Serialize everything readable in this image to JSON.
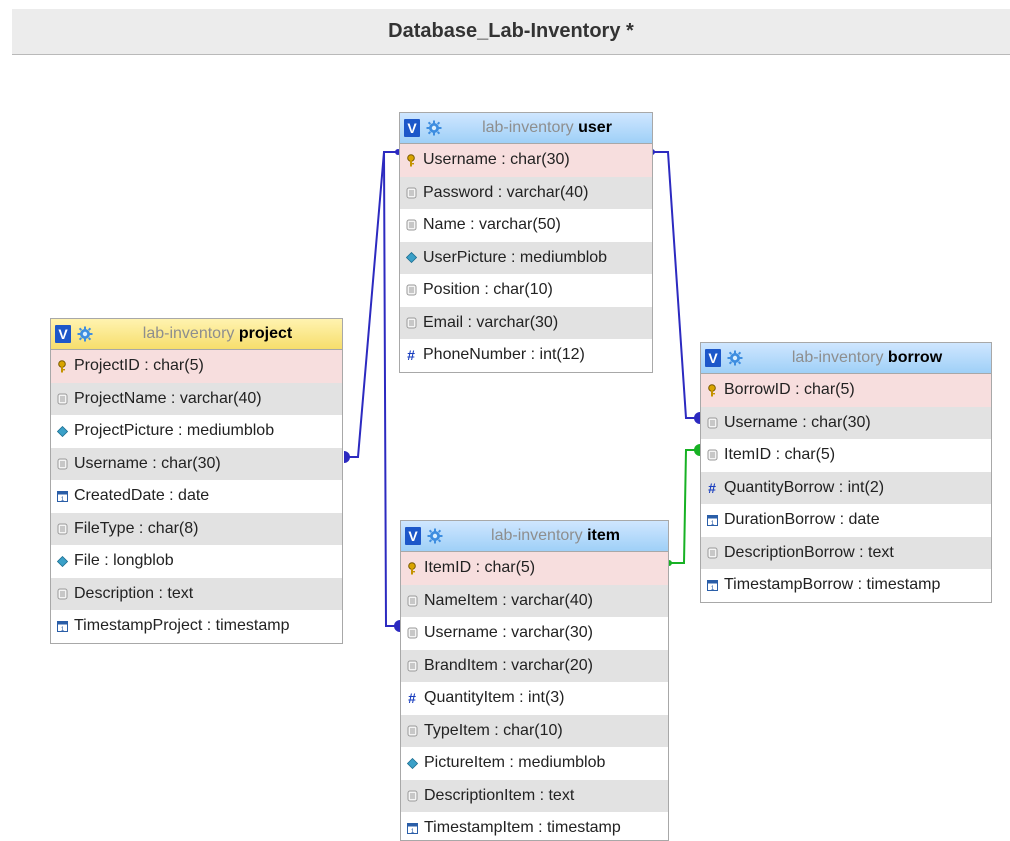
{
  "header": {
    "title": "Database_Lab-Inventory *"
  },
  "colors": {
    "link_blue": "#2c2ac0",
    "link_green": "#17b124",
    "header_blue": "#9fd0f7",
    "header_yellow": "#f7de6c",
    "pk_row": "#f7dede",
    "alt_row": "#e2e2e2"
  },
  "tables": {
    "user": {
      "db": "lab-inventory",
      "name": "user",
      "v_label": "V",
      "columns": [
        {
          "label": "Username : char(30)",
          "icon": "key-icon"
        },
        {
          "label": "Password : varchar(40)",
          "icon": "text-field-icon"
        },
        {
          "label": "Name : varchar(50)",
          "icon": "text-field-icon"
        },
        {
          "label": "UserPicture : mediumblob",
          "icon": "blob-icon"
        },
        {
          "label": "Position : char(10)",
          "icon": "text-field-icon"
        },
        {
          "label": "Email : varchar(30)",
          "icon": "text-field-icon"
        },
        {
          "label": "PhoneNumber : int(12)",
          "icon": "number-icon"
        }
      ]
    },
    "project": {
      "db": "lab-inventory",
      "name": "project",
      "v_label": "V",
      "columns": [
        {
          "label": "ProjectID : char(5)",
          "icon": "key-icon"
        },
        {
          "label": "ProjectName : varchar(40)",
          "icon": "text-field-icon"
        },
        {
          "label": "ProjectPicture : mediumblob",
          "icon": "blob-icon"
        },
        {
          "label": "Username : char(30)",
          "icon": "text-field-icon"
        },
        {
          "label": "CreatedDate : date",
          "icon": "date-icon"
        },
        {
          "label": "FileType : char(8)",
          "icon": "text-field-icon"
        },
        {
          "label": "File : longblob",
          "icon": "blob-icon"
        },
        {
          "label": "Description : text",
          "icon": "text-field-icon"
        },
        {
          "label": "TimestampProject : timestamp",
          "icon": "date-icon"
        }
      ]
    },
    "borrow": {
      "db": "lab-inventory",
      "name": "borrow",
      "v_label": "V",
      "columns": [
        {
          "label": "BorrowID : char(5)",
          "icon": "key-icon"
        },
        {
          "label": "Username : char(30)",
          "icon": "text-field-icon"
        },
        {
          "label": "ItemID : char(5)",
          "icon": "text-field-icon"
        },
        {
          "label": "QuantityBorrow : int(2)",
          "icon": "number-icon"
        },
        {
          "label": "DurationBorrow : date",
          "icon": "date-icon"
        },
        {
          "label": "DescriptionBorrow : text",
          "icon": "text-field-icon"
        },
        {
          "label": "TimestampBorrow : timestamp",
          "icon": "date-icon"
        }
      ]
    },
    "item": {
      "db": "lab-inventory",
      "name": "item",
      "v_label": "V",
      "columns": [
        {
          "label": "ItemID : char(5)",
          "icon": "key-icon"
        },
        {
          "label": "NameItem : varchar(40)",
          "icon": "text-field-icon"
        },
        {
          "label": "Username : varchar(30)",
          "icon": "text-field-icon"
        },
        {
          "label": "BrandItem : varchar(20)",
          "icon": "text-field-icon"
        },
        {
          "label": "QuantityItem : int(3)",
          "icon": "number-icon"
        },
        {
          "label": "TypeItem : char(10)",
          "icon": "text-field-icon"
        },
        {
          "label": "PictureItem : mediumblob",
          "icon": "blob-icon"
        },
        {
          "label": "DescriptionItem : text",
          "icon": "text-field-icon"
        },
        {
          "label": "TimestampItem : timestamp",
          "icon": "date-icon"
        }
      ]
    }
  }
}
